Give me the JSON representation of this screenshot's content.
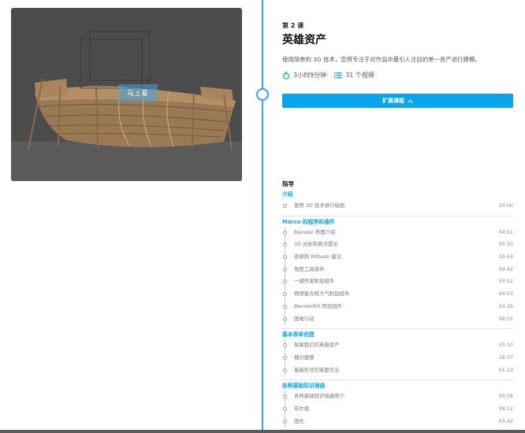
{
  "lesson": {
    "number": "第 2 课",
    "title": "英雄资产",
    "description": "使用简单的 3D 技术，您将专注于对作品中最引人注目的单一资产进行建模。",
    "duration": "3小时9分钟",
    "videos": "31 个视频",
    "expand_label": "扩展课程",
    "media_overlay": "马上看"
  },
  "guide": {
    "title": "指导",
    "sections": [
      {
        "title": "介绍",
        "items": [
          {
            "label": "使用 3D 技术进行绘画",
            "duration": "10:00"
          }
        ]
      },
      {
        "title": "Marco 的程序和插件",
        "items": [
          {
            "label": "Blender 界面介绍",
            "duration": "04:51"
          },
          {
            "label": "3D 光标和原点提示",
            "duration": "05:20"
          },
          {
            "label": "资源和 Ritbash 建议",
            "duration": "10:43"
          },
          {
            "label": "角度工具插件",
            "duration": "04:42"
          },
          {
            "label": "一键伤害附加组件",
            "duration": "03:52"
          },
          {
            "label": "物理星光和大气附加组件",
            "duration": "04:03"
          },
          {
            "label": "BlenderKit 附加组件",
            "duration": "03:26"
          },
          {
            "label": "困难行动",
            "duration": "08:05"
          }
        ]
      },
      {
        "title": "基本表单创建",
        "items": [
          {
            "label": "探索我们的英雄资产",
            "duration": "03:10"
          },
          {
            "label": "细分建模",
            "duration": "18:37"
          },
          {
            "label": "基础形式的家庭作业",
            "duration": "01:13"
          }
        ]
      },
      {
        "title": "各种基础知识插曲",
        "items": [
          {
            "label": "各种基础知识插曲简介",
            "duration": "00:56"
          },
          {
            "label": "布尔值",
            "duration": "09:12"
          },
          {
            "label": "固化",
            "duration": "03:42"
          }
        ]
      }
    ]
  },
  "colors": {
    "accent": "#0aa4ea",
    "timeline": "#2fa7e6"
  },
  "icons": {
    "duration": "stopwatch-icon",
    "videos": "list-icon",
    "expand": "chevron-up-icon"
  }
}
